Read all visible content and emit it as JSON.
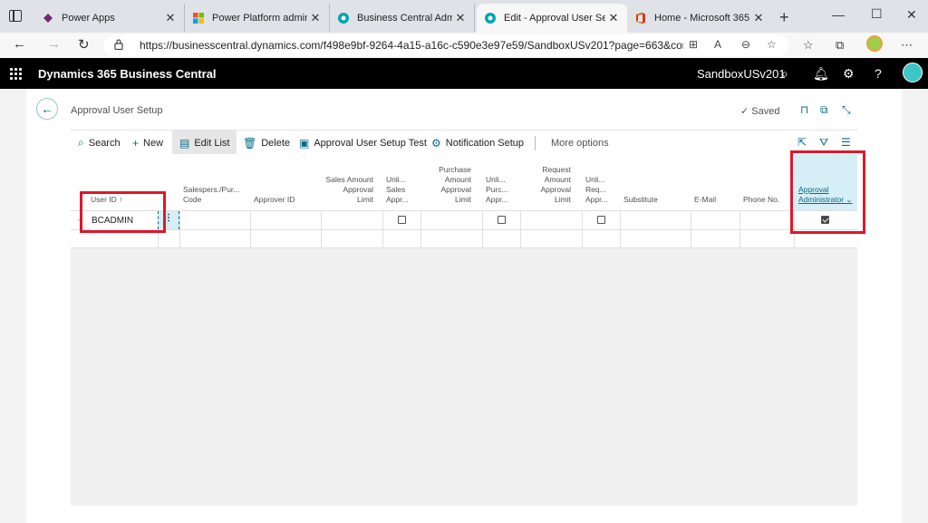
{
  "browser": {
    "tabs": [
      {
        "title": "Power Apps",
        "color": "#742774"
      },
      {
        "title": "Power Platform admin cer",
        "color": "#f25022"
      },
      {
        "title": "Business Central Admin Ce",
        "color": "#00a4b4"
      },
      {
        "title": "Edit - Approval User Setup",
        "color": "#00a4b4"
      },
      {
        "title": "Home - Microsoft 365 adm",
        "color": "#d83b01"
      }
    ],
    "url": "https://businesscentral.dynamics.com/f498e9bf-9264-4a15-a16c-c590e3e97e59/SandboxUSv201?page=663&company..."
  },
  "app": {
    "title": "Dynamics 365 Business Central",
    "environment": "SandboxUSv201"
  },
  "page": {
    "title": "Approval User Setup",
    "saved": "Saved",
    "actions": {
      "search": "Search",
      "new": "New",
      "edit_list": "Edit List",
      "delete": "Delete",
      "test": "Approval User Setup Test",
      "notification": "Notification Setup",
      "more": "More options"
    }
  },
  "table": {
    "headers": {
      "user_id": "User ID ↑",
      "salesperson": "Salespers./Pur...\nCode",
      "approver": "Approver ID",
      "sales_amount": "Sales Amount\nApproval\nLimit",
      "unl_sales": "Unli...\nSales\nAppr...",
      "purchase_amount": "Purchase\nAmount\nApproval\nLimit",
      "unl_purch": "Unli...\nPurc...\nAppr...",
      "request_amount": "Request\nAmount\nApproval\nLimit",
      "unl_req": "Unli...\nReq...\nAppr...",
      "substitute": "Substitute",
      "email": "E-Mail",
      "phone": "Phone No.",
      "admin": "Approval\nAdministrator ⌄"
    },
    "rows": [
      {
        "user_id": "BCADMIN",
        "unl_sales": false,
        "unl_purch": false,
        "unl_req": false,
        "admin": true
      }
    ]
  }
}
